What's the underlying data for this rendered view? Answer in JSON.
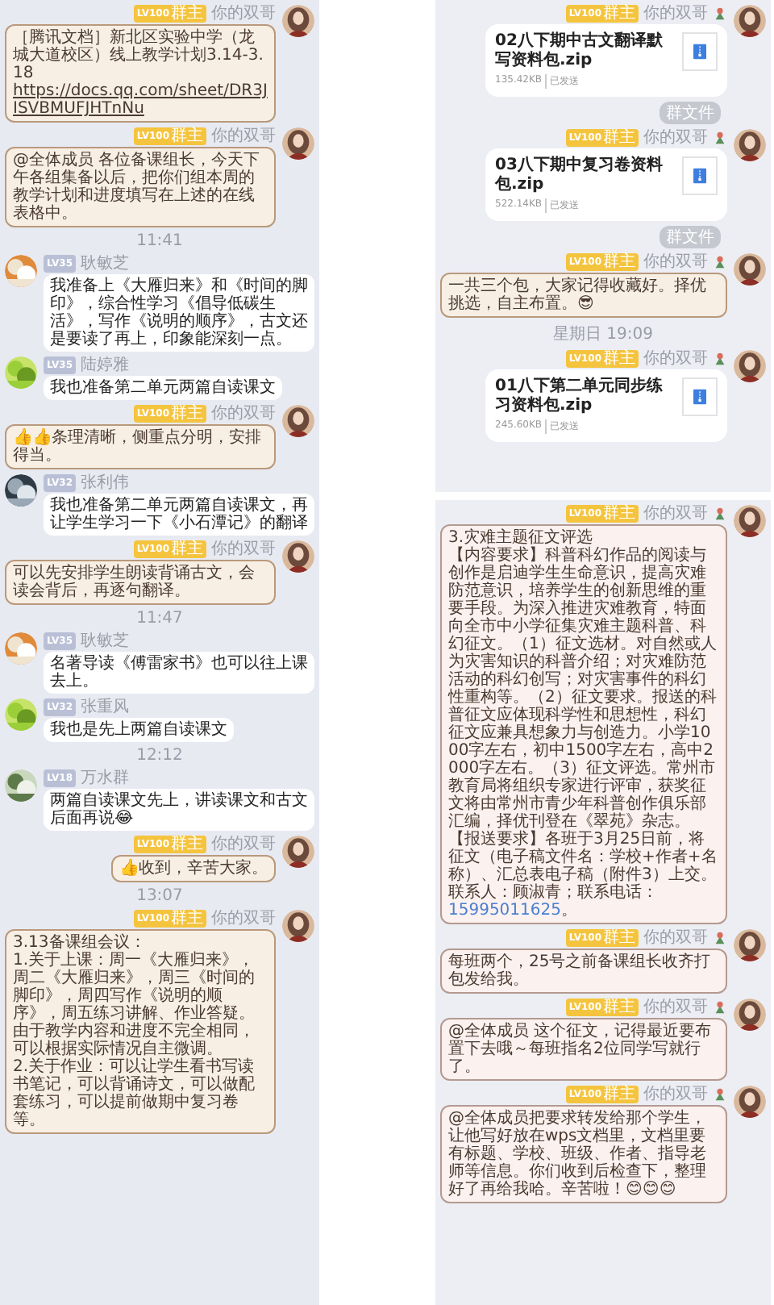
{
  "panels": [
    {
      "items": [
        {
          "kind": "text",
          "outgoing": true,
          "level_badge": "LV100",
          "role": "群主",
          "name": "你的双哥",
          "parts": [
            {
              "kind": "text",
              "text": "［腾讯文档］新北区实验中学（龙城大道校区）线上教学计划3.14-3.18 "
            },
            {
              "kind": "link",
              "text": "https://docs.qq.com/sheet/DR3JISVBMUFJHTnNu"
            }
          ]
        },
        {
          "kind": "text",
          "outgoing": true,
          "level_badge": "LV100",
          "role": "群主",
          "name": "你的双哥",
          "parts": [
            {
              "kind": "text",
              "text": "@全体成员 各位备课组长，今天下午各组集备以后，把你们组本周的教学计划和进度填写在上述的在线表格中。"
            }
          ]
        },
        {
          "kind": "time",
          "text": "11:41"
        },
        {
          "kind": "text",
          "outgoing": false,
          "level_badge": "LV35",
          "name": "耿敏芝",
          "parts": [
            {
              "kind": "text",
              "text": "我准备上《大雁归来》和《时间的脚印》，综合性学习《倡导低碳生活》，写作《说明的顺序》，古文还是要读了再上，印象能深刻一点。"
            }
          ]
        },
        {
          "kind": "text",
          "outgoing": false,
          "level_badge": "LV35",
          "name": "陆婷雅",
          "parts": [
            {
              "kind": "text",
              "text": "我也准备第二单元两篇自读课文"
            }
          ]
        },
        {
          "kind": "text",
          "outgoing": true,
          "level_badge": "LV100",
          "role": "群主",
          "name": "你的双哥",
          "parts": [
            {
              "kind": "text",
              "text": "👍👍条理清晰，侧重点分明，安排得当。"
            }
          ]
        },
        {
          "kind": "text",
          "outgoing": false,
          "level_badge": "LV32",
          "name": "张利伟",
          "parts": [
            {
              "kind": "text",
              "text": "我也准备第二单元两篇自读课文，再让学生学习一下《小石潭记》的翻译"
            }
          ]
        },
        {
          "kind": "text",
          "outgoing": true,
          "level_badge": "LV100",
          "role": "群主",
          "name": "你的双哥",
          "parts": [
            {
              "kind": "text",
              "text": "可以先安排学生朗读背诵古文，会读会背后，再逐句翻译。"
            }
          ]
        },
        {
          "kind": "time",
          "text": "11:47"
        },
        {
          "kind": "text",
          "outgoing": false,
          "level_badge": "LV35",
          "name": "耿敏芝",
          "parts": [
            {
              "kind": "text",
              "text": "名著导读《傅雷家书》也可以往上课去上。"
            }
          ]
        },
        {
          "kind": "text",
          "outgoing": false,
          "level_badge": "LV32",
          "name": "张重风",
          "parts": [
            {
              "kind": "text",
              "text": "我也是先上两篇自读课文"
            }
          ]
        },
        {
          "kind": "time",
          "text": "12:12"
        },
        {
          "kind": "text",
          "outgoing": false,
          "level_badge": "LV18",
          "name": "万水群",
          "parts": [
            {
              "kind": "text",
              "text": "两篇自读课文先上，讲读课文和古文后面再说😂"
            }
          ]
        },
        {
          "kind": "text",
          "outgoing": true,
          "level_badge": "LV100",
          "role": "群主",
          "name": "你的双哥",
          "parts": [
            {
              "kind": "text",
              "text": "👍收到，辛苦大家。"
            }
          ]
        },
        {
          "kind": "time",
          "text": "13:07"
        },
        {
          "kind": "text",
          "outgoing": true,
          "level_badge": "LV100",
          "role": "群主",
          "name": "你的双哥",
          "parts": [
            {
              "kind": "text",
              "text": "3.13备课组会议："
            },
            {
              "kind": "break"
            },
            {
              "kind": "text",
              "text": "1.关于上课：周一《大雁归来》，周二《大雁归来》，周三《时间的脚印》，周四写作《说明的顺序》，周五练习讲解、作业答疑。由于教学内容和进度不完全相同，可以根据实际情况自主微调。"
            },
            {
              "kind": "break"
            },
            {
              "kind": "text",
              "text": "2.关于作业：可以让学生看书写读书笔记，可以背诵诗文，可以做配套练习，可以提前做期中复习卷等。"
            }
          ]
        }
      ]
    },
    {
      "items": [
        {
          "kind": "file",
          "outgoing": true,
          "level_badge": "LV100",
          "role": "群主",
          "name": "你的双哥",
          "medal": true,
          "file_name": "02八下期中古文翻译默写资料包.zip",
          "size": "135.42KB",
          "status": "已发送"
        },
        {
          "kind": "tag",
          "text": "群文件"
        },
        {
          "kind": "file",
          "outgoing": true,
          "level_badge": "LV100",
          "role": "群主",
          "name": "你的双哥",
          "medal": true,
          "file_name": "03八下期中复习卷资料包.zip",
          "size": "522.14KB",
          "status": "已发送"
        },
        {
          "kind": "tag",
          "text": "群文件"
        },
        {
          "kind": "text",
          "outgoing": true,
          "level_badge": "LV100",
          "role": "群主",
          "name": "你的双哥",
          "medal": true,
          "parts": [
            {
              "kind": "text",
              "text": "一共三个包，大家记得收藏好。择优挑选，自主布置。😎"
            }
          ]
        },
        {
          "kind": "time",
          "text": "星期日 19:09"
        },
        {
          "kind": "file",
          "outgoing": true,
          "level_badge": "LV100",
          "role": "群主",
          "name": "你的双哥",
          "medal": true,
          "file_name": "01八下第二单元同步练习资料包.zip",
          "size": "245.60KB",
          "status": "已发送"
        }
      ]
    },
    {
      "items": [
        {
          "kind": "text",
          "outgoing": true,
          "level_badge": "LV100",
          "role": "群主",
          "name": "你的双哥",
          "medal": true,
          "parts": [
            {
              "kind": "text",
              "text": "3.灾难主题征文评选"
            },
            {
              "kind": "break"
            },
            {
              "kind": "text",
              "text": "【内容要求】科普科幻作品的阅读与创作是启迪学生生命意识，提高灾难防范意识，培养学生的创新思维的重要手段。为深入推进灾难教育，特面向全市中小学征集灾难主题科普、科幻征文。（1）征文选材。对自然或人为灾害知识的科普介绍；对灾难防范活动的科幻创写；对灾害事件的科幻性重构等。（2）征文要求。报送的科普征文应体现科学性和思想性，科幻征文应兼具想象力与创造力。小学1000字左右，初中1500字左右，高中2000字左右。（3）征文评选。常州市教育局将组织专家进行评审，获奖征文将由常州市青少年科普创作俱乐部汇编，择优刊登在《翠苑》杂志。"
            },
            {
              "kind": "break"
            },
            {
              "kind": "text",
              "text": "【报送要求】各班于3月25日前，将征文（电子稿文件名：学校+作者+名称）、汇总表电子稿（附件3）上交。联系人：顾淑青；联系电话："
            },
            {
              "kind": "link",
              "text": "15995011625"
            },
            {
              "kind": "text",
              "text": "。"
            }
          ]
        },
        {
          "kind": "text",
          "outgoing": true,
          "level_badge": "LV100",
          "role": "群主",
          "name": "你的双哥",
          "medal": true,
          "parts": [
            {
              "kind": "text",
              "text": "每班两个，25号之前备课组长收齐打包发给我。"
            }
          ]
        },
        {
          "kind": "text",
          "outgoing": true,
          "level_badge": "LV100",
          "role": "群主",
          "name": "你的双哥",
          "medal": true,
          "parts": [
            {
              "kind": "text",
              "text": "@全体成员 这个征文，记得最近要布置下去哦～每班指名2位同学写就行了。"
            }
          ]
        },
        {
          "kind": "text",
          "outgoing": true,
          "level_badge": "LV100",
          "role": "群主",
          "name": "你的双哥",
          "medal": true,
          "parts": [
            {
              "kind": "text",
              "text": "@全体成员把要求转发给那个学生，让他写好放在wps文档里，文档里要有标题、学校、班级、作者、指导老师等信息。你们收到后检查下，整理好了再给我哈。辛苦啦！😊😊😊"
            }
          ]
        }
      ]
    }
  ]
}
